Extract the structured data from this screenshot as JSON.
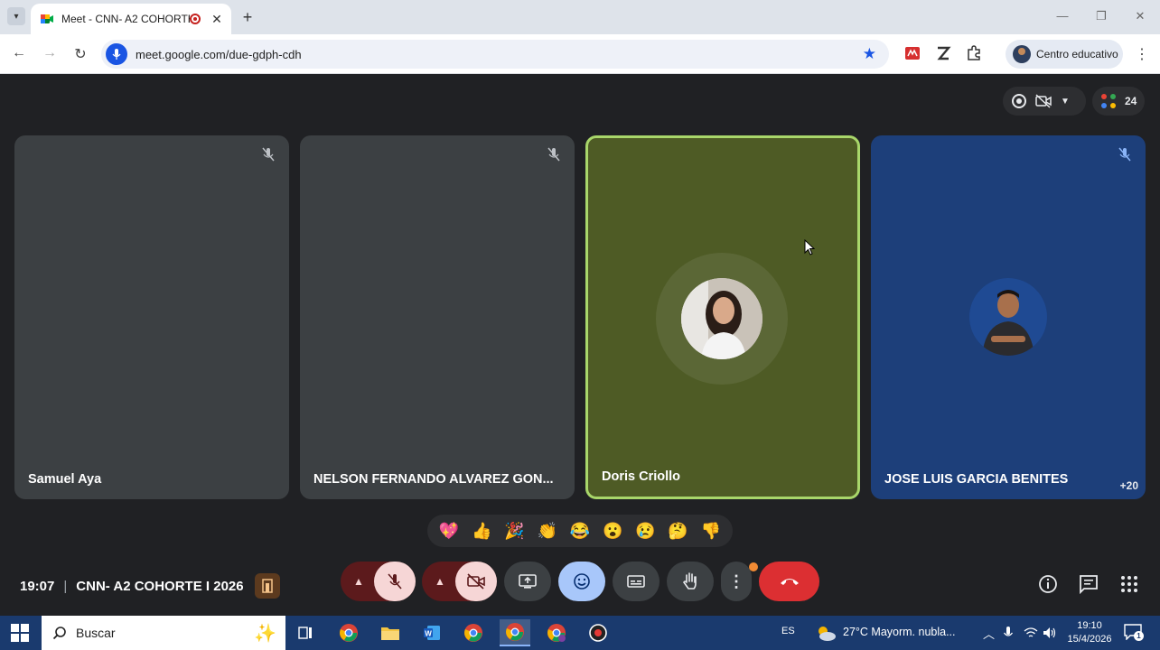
{
  "browser": {
    "tab_title": "Meet - CNN- A2 COHORTE",
    "tab_close": "✕",
    "new_tab": "+",
    "url": "meet.google.com/due-gdph-cdh",
    "profile_name": "Centro educativo",
    "window_controls": [
      "—",
      "❐",
      "✕"
    ]
  },
  "meet": {
    "participants_count": "24",
    "overflow_count": "+20",
    "tiles": [
      {
        "name": "Samuel Aya",
        "muted": true,
        "bg": "#3c4043"
      },
      {
        "name": "NELSON FERNANDO ALVAREZ GON...",
        "muted": true,
        "bg": "#3c4043"
      },
      {
        "name": "Doris Criollo",
        "muted": false,
        "bg": "#4e5b25",
        "speaking": true
      },
      {
        "name": "JOSE LUIS GARCIA BENITES",
        "muted": true,
        "bg": "#1d3f7a"
      }
    ],
    "reactions": [
      "💖",
      "👍",
      "🎉",
      "👏",
      "😂",
      "😮",
      "😢",
      "🤔",
      "👎"
    ],
    "time": "19:07",
    "separator": "|",
    "meeting_name": "CNN- A2 COHORTE I 2026"
  },
  "taskbar": {
    "search_placeholder": "Buscar",
    "lang": "ES",
    "weather": "27°C  Mayorm. nubla...",
    "time": "19:10",
    "date": "15/4/2026",
    "notifications": "1"
  },
  "colors": {
    "accent_blue": "#1a55e3",
    "hangup_red": "#dc2f32",
    "speaking_border": "#a8d66a",
    "meet_bg": "#202124"
  }
}
